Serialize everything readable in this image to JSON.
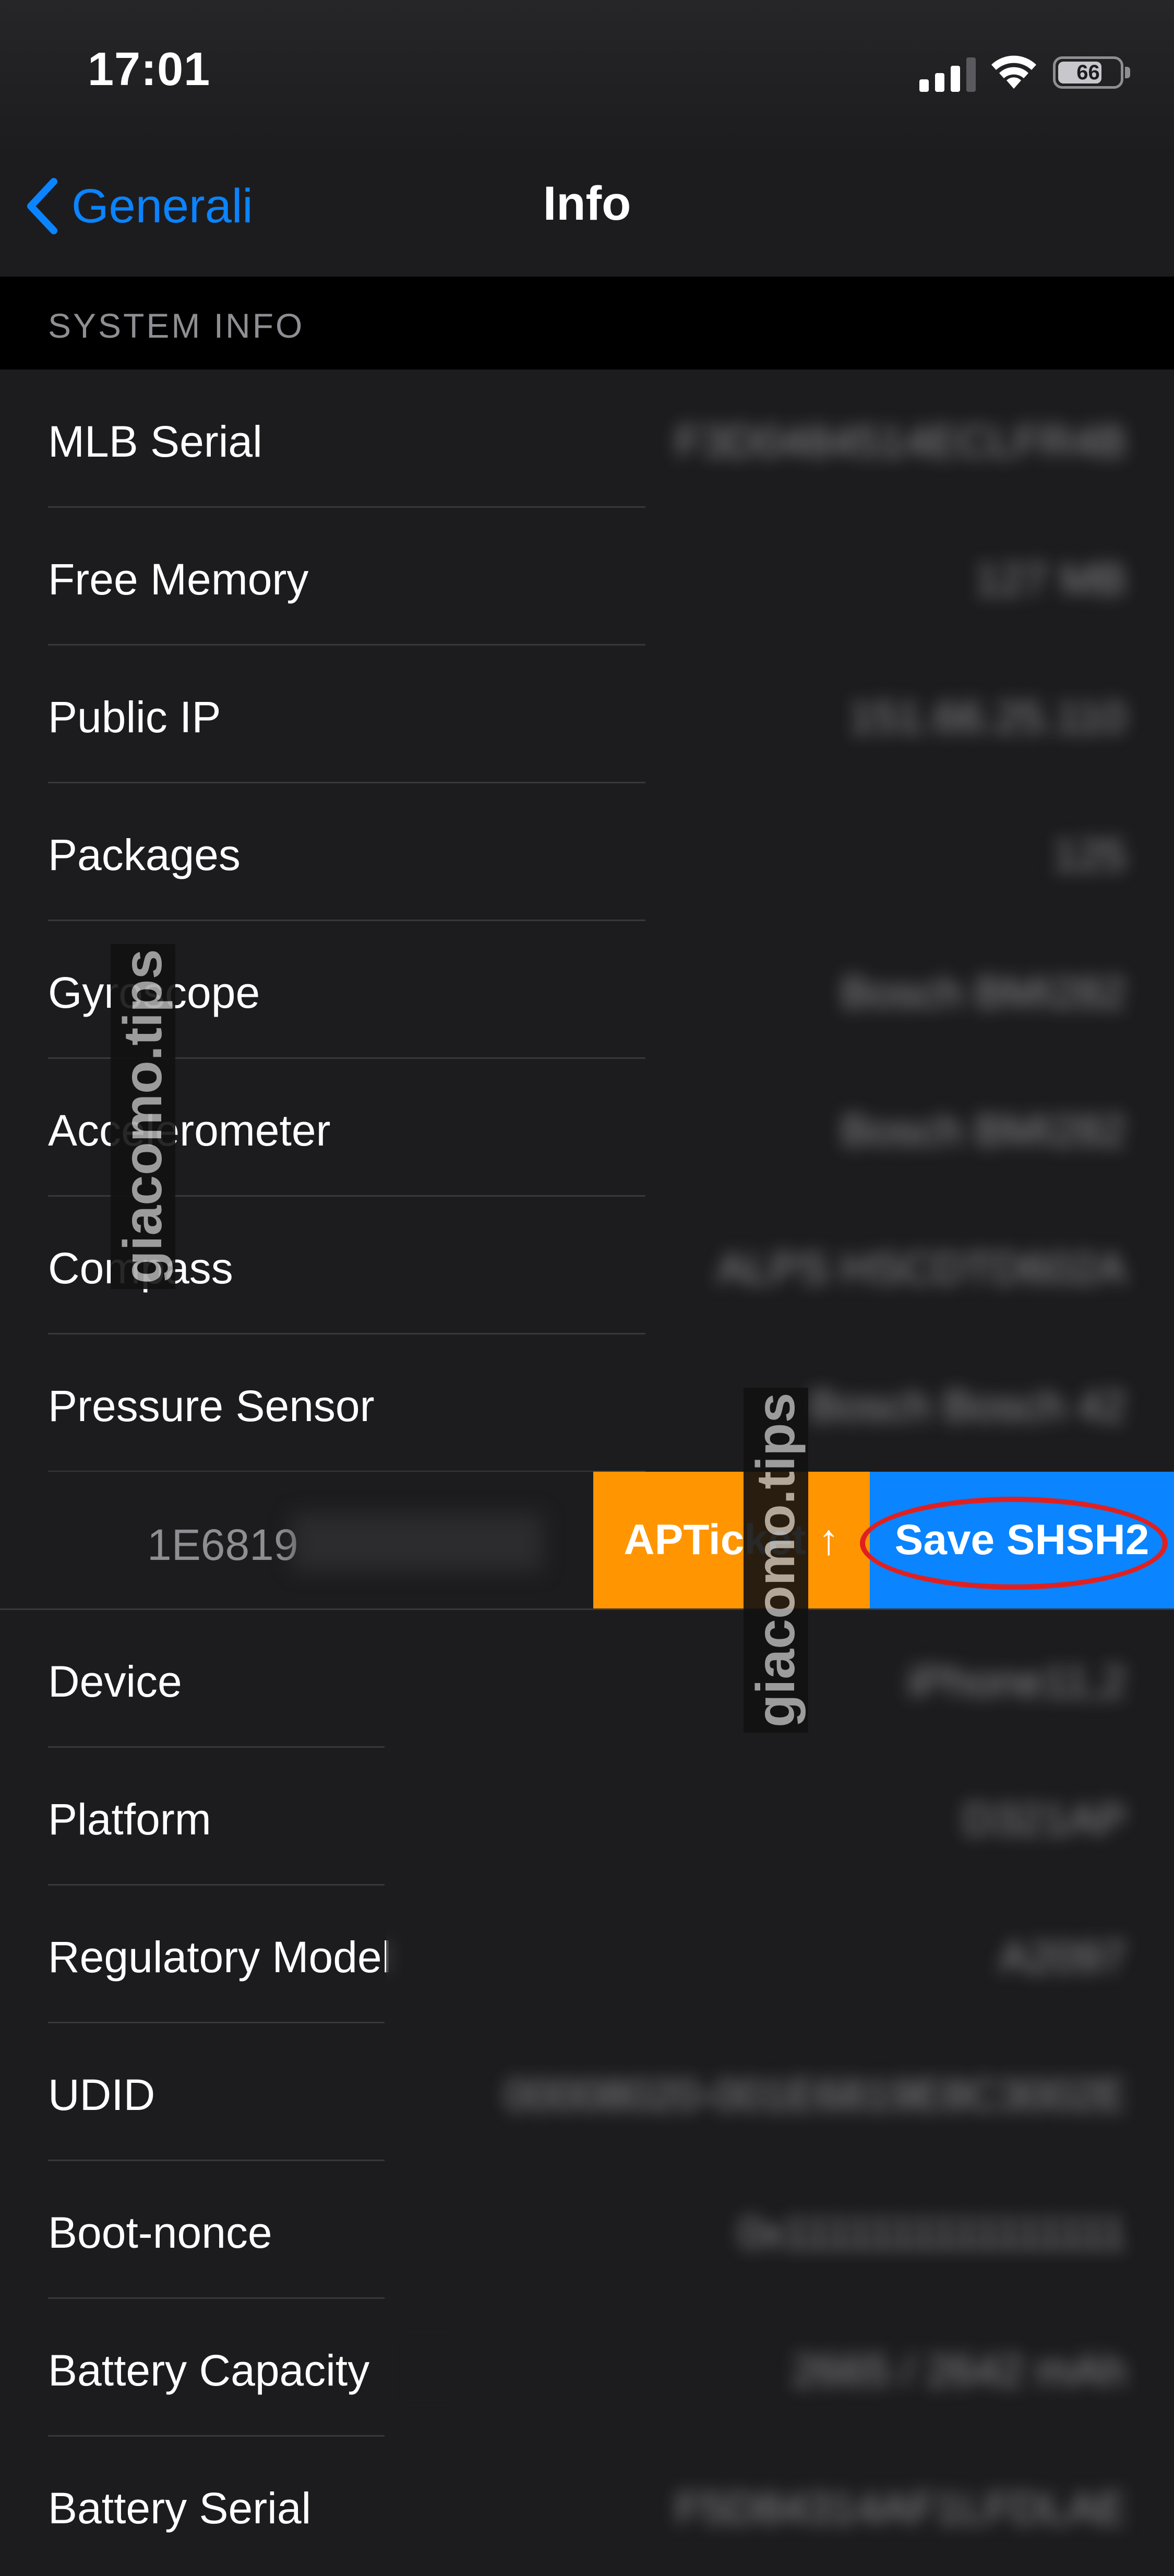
{
  "status_bar": {
    "time": "17:01",
    "battery": "66"
  },
  "nav": {
    "back_label": "Generali",
    "title": "Info"
  },
  "section_header": "SYSTEM INFO",
  "rows_top": [
    {
      "label": "MLB Serial",
      "value": "F3D0484514ECLFR4B"
    },
    {
      "label": "Free Memory",
      "value": "127 MB"
    },
    {
      "label": "Public IP",
      "value": "151.66.25.110"
    },
    {
      "label": "Packages",
      "value": "125"
    },
    {
      "label": "Gyroscope",
      "value": "Bosch BMI282"
    },
    {
      "label": "Accelerometer",
      "value": "Bosch BMI282"
    },
    {
      "label": "Compass",
      "value": "ALPS HSCDTD602A"
    },
    {
      "label": "Pressure Sensor",
      "value": "Bosch Bosch 42"
    }
  ],
  "swiped_row": {
    "value_prefix": "1E6819",
    "apticket_label": "APTicket ↑",
    "save_shsh2_label": "Save SHSH2"
  },
  "rows_bottom": [
    {
      "label": "Device",
      "value": "iPhone11,2"
    },
    {
      "label": "Platform",
      "value": "D321AP"
    },
    {
      "label": "Regulatory Model",
      "value": "A2097"
    },
    {
      "label": "UDID",
      "value": "00008020-001E6819E8C3002E"
    },
    {
      "label": "Boot-nonce",
      "value": "0x1111111111111111"
    },
    {
      "label": "Battery Capacity",
      "value": "2665 / 2642 mAh"
    },
    {
      "label": "Battery Serial",
      "value": "F5D84314AF1LFDLAE"
    }
  ],
  "watermark": "giacomo.tips",
  "colors": {
    "accent": "#0a84ff",
    "apticket": "#ff9500",
    "background": "#1c1c1e",
    "highlight_circle": "#e02020"
  }
}
